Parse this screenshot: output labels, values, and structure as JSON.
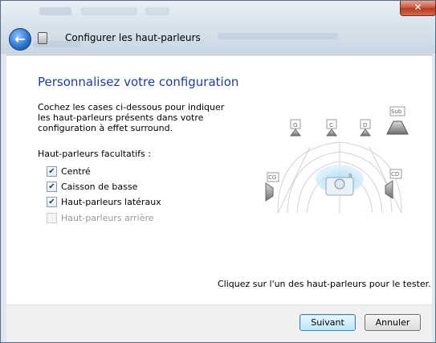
{
  "window": {
    "title": "Configurer les haut-parleurs",
    "close_glyph": "✕",
    "back_glyph": "←"
  },
  "main": {
    "heading": "Personnalisez votre configuration",
    "description": "Cochez les cases ci-dessous pour indiquer les haut-parleurs présents dans votre configuration à effet surround.",
    "optional_label": "Haut-parleurs facultatifs :",
    "options": [
      {
        "label": "Centré",
        "checked": true,
        "enabled": true
      },
      {
        "label": "Caisson de basse",
        "checked": true,
        "enabled": true
      },
      {
        "label": "Haut-parleurs latéraux",
        "checked": true,
        "enabled": true
      },
      {
        "label": "Haut-parleurs arrière",
        "checked": false,
        "enabled": false
      }
    ],
    "hint": "Cliquez sur l'un des haut-parleurs pour le tester."
  },
  "diagram": {
    "speakers": {
      "front_left": "G",
      "center": "C",
      "front_right": "D",
      "subwoofer": "Sub",
      "side_left": "CG",
      "side_right": "CD"
    },
    "listener_label": "B"
  },
  "footer": {
    "next_label": "Suivant",
    "cancel_label": "Annuler"
  },
  "colors": {
    "heading": "#1e3f8f",
    "accent": "#3c7fb1"
  }
}
